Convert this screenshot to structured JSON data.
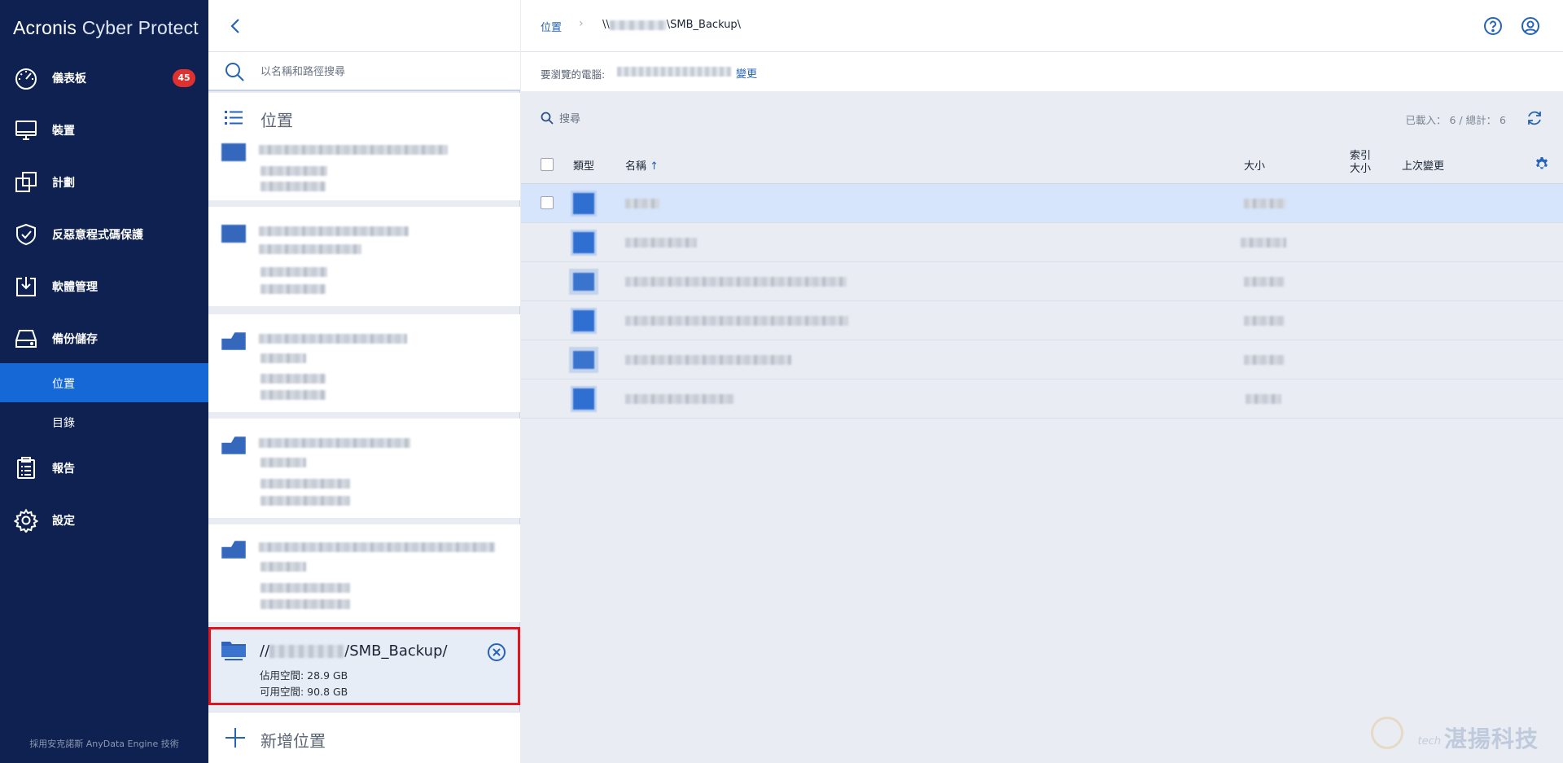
{
  "sidebar": {
    "brand_main": "Acronis",
    "brand_sub": "Cyber Protect",
    "items": [
      {
        "label": "儀表板",
        "icon": "dashboard-icon",
        "badge": "45"
      },
      {
        "label": "裝置",
        "icon": "monitor-icon"
      },
      {
        "label": "計劃",
        "icon": "plans-icon"
      },
      {
        "label": "反惡意程式碼保護",
        "icon": "shield-check-icon"
      },
      {
        "label": "軟體管理",
        "icon": "software-download-icon"
      },
      {
        "label": "備份儲存",
        "icon": "storage-drive-icon"
      }
    ],
    "subitems": [
      {
        "label": "位置",
        "active": true
      },
      {
        "label": "目錄",
        "active": false
      }
    ],
    "items2": [
      {
        "label": "報告",
        "icon": "report-clipboard-icon"
      },
      {
        "label": "設定",
        "icon": "gear-icon"
      }
    ],
    "powered_by": "採用安克諾斯 AnyData Engine 技術",
    "colors": {
      "bg": "#0e2150",
      "active": "#1668d6",
      "badge": "#e03131"
    }
  },
  "locations_panel": {
    "search_placeholder": "以名稱和路徑搜尋",
    "title": "位置",
    "selected_location": {
      "name_prefix": "//",
      "name_suffix": "/SMB_Backup/",
      "occupied": "佔用空間: 28.9 GB",
      "free": "可用空間: 90.8 GB"
    },
    "add_location": "新增位置"
  },
  "main": {
    "breadcrumb_root": "位置",
    "breadcrumb_path_prefix": "\\\\",
    "breadcrumb_path_suffix": "\\SMB_Backup\\",
    "machine_label": "要瀏覽的電腦:",
    "change_link": "變更",
    "search_placeholder": "搜尋",
    "loaded_count": "已載入： 6 / 總計： 6",
    "columns": {
      "type": "類型",
      "name": "名稱",
      "size": "大小",
      "index_size_line1": "索引",
      "index_size_line2": "大小",
      "last_modified": "上次變更"
    },
    "sort_indicator": "↑"
  },
  "watermark": {
    "text": "湛揚科技",
    "small": "tech"
  }
}
